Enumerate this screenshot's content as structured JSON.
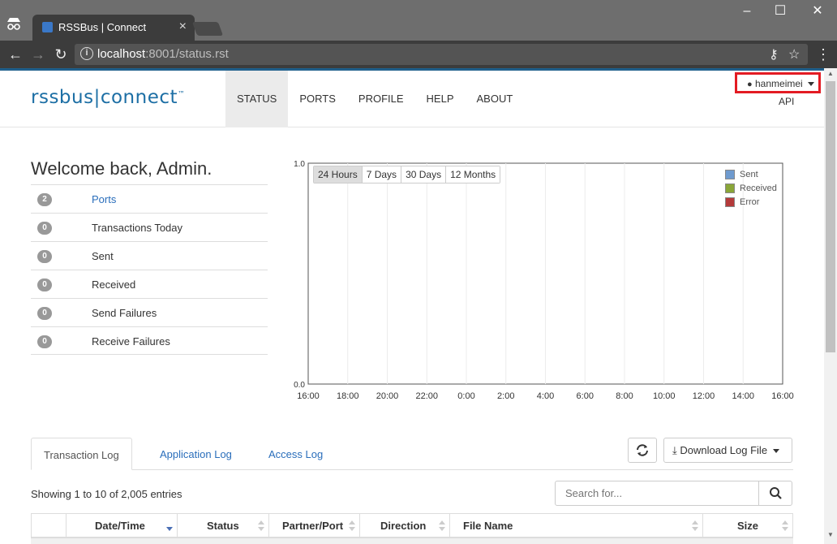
{
  "browser": {
    "tab_title": "RSSBus | Connect",
    "url_host": "localhost",
    "url_path": ":8001/status.rst"
  },
  "header": {
    "logo_left": "rssbus",
    "logo_right": "connect",
    "logo_tm": "™",
    "nav": [
      "STATUS",
      "PORTS",
      "PROFILE",
      "HELP",
      "ABOUT"
    ],
    "active_nav": "STATUS",
    "user": "hanmeimei",
    "api_link": "API"
  },
  "welcome": "Welcome back, Admin.",
  "stats": [
    {
      "count": "2",
      "label": "Ports",
      "link": true
    },
    {
      "count": "0",
      "label": "Transactions Today",
      "link": false
    },
    {
      "count": "0",
      "label": "Sent",
      "link": false
    },
    {
      "count": "0",
      "label": "Received",
      "link": false
    },
    {
      "count": "0",
      "label": "Send Failures",
      "link": false
    },
    {
      "count": "0",
      "label": "Receive Failures",
      "link": false
    }
  ],
  "chart_data": {
    "type": "bar",
    "ylim": [
      0.0,
      1.0
    ],
    "y_ticks": [
      "1.0",
      "0.0"
    ],
    "categories": [
      "16:00",
      "18:00",
      "20:00",
      "22:00",
      "0:00",
      "2:00",
      "4:00",
      "6:00",
      "8:00",
      "10:00",
      "12:00",
      "14:00",
      "16:00"
    ],
    "series": [
      {
        "name": "Sent",
        "color": "#6f9bcf",
        "values": [
          0,
          0,
          0,
          0,
          0,
          0,
          0,
          0,
          0,
          0,
          0,
          0,
          0
        ]
      },
      {
        "name": "Received",
        "color": "#8aa638",
        "values": [
          0,
          0,
          0,
          0,
          0,
          0,
          0,
          0,
          0,
          0,
          0,
          0,
          0
        ]
      },
      {
        "name": "Error",
        "color": "#b43a3a",
        "values": [
          0,
          0,
          0,
          0,
          0,
          0,
          0,
          0,
          0,
          0,
          0,
          0,
          0
        ]
      }
    ],
    "ranges": [
      "24 Hours",
      "7 Days",
      "30 Days",
      "12 Months"
    ],
    "active_range": "24 Hours",
    "grid": true,
    "legend_position": "top-right"
  },
  "log": {
    "tabs": [
      "Transaction Log",
      "Application Log",
      "Access Log"
    ],
    "active_tab": "Transaction Log",
    "download_label": "Download Log File",
    "showing": "Showing 1 to 10 of 2,005 entries",
    "search_placeholder": "Search for...",
    "columns": [
      "Date/Time",
      "Status",
      "Partner/Port",
      "Direction",
      "File Name",
      "Size"
    ]
  }
}
